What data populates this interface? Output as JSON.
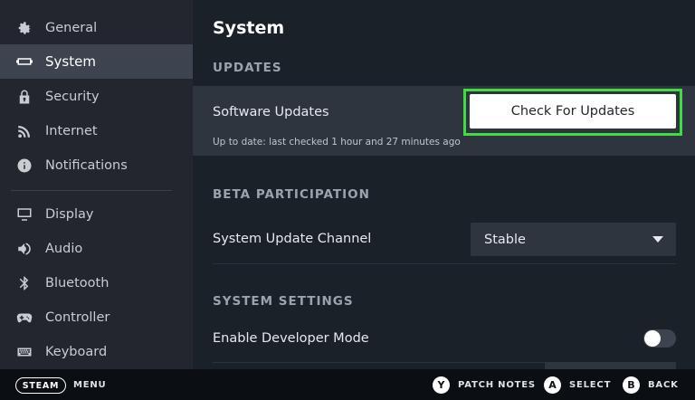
{
  "sidebar": {
    "items": [
      {
        "label": "General",
        "icon": "gear-icon"
      },
      {
        "label": "System",
        "icon": "system-icon",
        "active": true
      },
      {
        "label": "Security",
        "icon": "lock-icon"
      },
      {
        "label": "Internet",
        "icon": "wifi-icon"
      },
      {
        "label": "Notifications",
        "icon": "info-icon"
      },
      {
        "label": "Display",
        "icon": "monitor-icon"
      },
      {
        "label": "Audio",
        "icon": "speaker-icon"
      },
      {
        "label": "Bluetooth",
        "icon": "bluetooth-icon"
      },
      {
        "label": "Controller",
        "icon": "gamepad-icon"
      },
      {
        "label": "Keyboard",
        "icon": "keyboard-icon"
      }
    ]
  },
  "main": {
    "title": "System",
    "updates": {
      "heading": "UPDATES",
      "software_label": "Software Updates",
      "status": "Up to date: last checked 1 hour and 27 minutes ago",
      "check_button": "Check For Updates"
    },
    "beta": {
      "heading": "BETA PARTICIPATION",
      "channel_label": "System Update Channel",
      "channel_value": "Stable"
    },
    "system_settings": {
      "heading": "SYSTEM SETTINGS",
      "dev_mode_label": "Enable Developer Mode",
      "dev_mode_on": false
    }
  },
  "footer": {
    "steam": "STEAM",
    "menu": "MENU",
    "y_key": "Y",
    "patch_notes": "PATCH NOTES",
    "a_key": "A",
    "select": "SELECT",
    "b_key": "B",
    "back": "BACK"
  },
  "colors": {
    "accent_highlight": "#3fdd3f",
    "sidebar_bg": "#23262e",
    "main_bg": "#1b2129"
  }
}
